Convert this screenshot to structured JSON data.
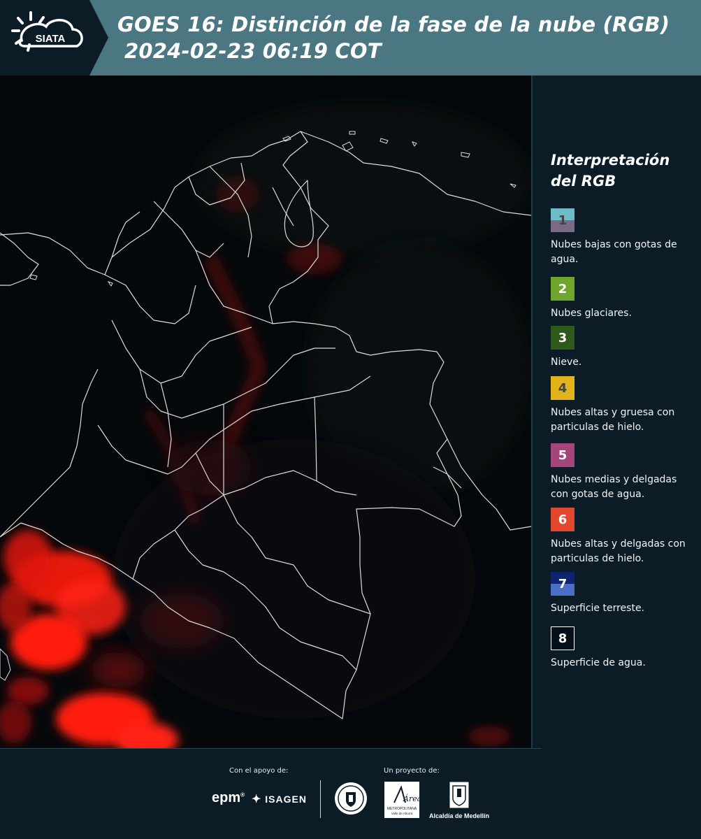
{
  "header": {
    "logo_text": "SIATA",
    "title_line1": "GOES 16: Distinción de la fase de la nube (RGB)",
    "title_line2": "2024-02-23 06:19 COT"
  },
  "legend": {
    "title_line1": "Interpretación",
    "title_line2": "del RGB",
    "items": [
      {
        "number": "1",
        "label": "Nubes bajas con gotas de agua.",
        "color_top": "#6dbcc7",
        "color_bottom": "#7a6b85",
        "text_color": "#444444"
      },
      {
        "number": "2",
        "label": "Nubes glaciares.",
        "color_top": "#6fa52a",
        "color_bottom": "#6fa52a",
        "text_color": "#ffffff"
      },
      {
        "number": "3",
        "label": "Nieve.",
        "color_top": "#2d5a1a",
        "color_bottom": "#2d5a1a",
        "text_color": "#ffffff"
      },
      {
        "number": "4",
        "label": "Nubes altas y gruesa con particulas de hielo.",
        "color_top": "#e2b31b",
        "color_bottom": "#e2b31b",
        "text_color": "#444444"
      },
      {
        "number": "5",
        "label": "Nubes medias y delgadas con gotas de agua.",
        "color_top": "#a5457c",
        "color_bottom": "#a5457c",
        "text_color": "#ffffff"
      },
      {
        "number": "6",
        "label": "Nubes altas y delgadas con particulas de hielo.",
        "color_top": "#e3472d",
        "color_bottom": "#e3472d",
        "text_color": "#ffffff"
      },
      {
        "number": "7",
        "label": "Superficie terreste.",
        "color_top": "#0f2470",
        "color_bottom": "#4a6fc6",
        "text_color": "#ffffff"
      },
      {
        "number": "8",
        "label": "Superficie de agua.",
        "color_top": "#06101a",
        "color_bottom": "#06101a",
        "text_color": "#ffffff"
      }
    ]
  },
  "footer": {
    "support_label": "Con el apoyo de:",
    "project_label": "Un proyecto de:",
    "sponsors": [
      "epm",
      "ISAGEN"
    ],
    "area_logo_text": "Área",
    "area_logo_subtext": "METROPOLITANA",
    "area_logo_subtext2": "Valle de Aburrá",
    "alcaldia_label": "Alcaldía de Medellín"
  },
  "colors": {
    "header_bar": "#4b7783",
    "background": "#0c1c26",
    "map_background": "#05070a",
    "cloud_red": "#ff1a10",
    "borders": "#dddddd"
  }
}
